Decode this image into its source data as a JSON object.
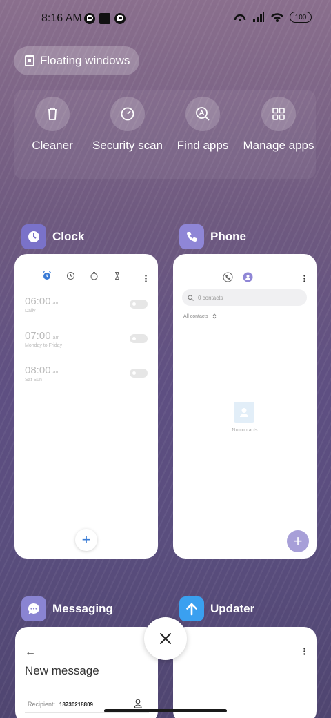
{
  "status_bar": {
    "time": "8:16 AM",
    "battery": "100"
  },
  "floating_windows": {
    "label": "Floating windows"
  },
  "shortcuts": [
    {
      "label": "Cleaner",
      "icon": "trash-icon"
    },
    {
      "label": "Security scan",
      "icon": "security-gauge-icon"
    },
    {
      "label": "Find apps",
      "icon": "find-apps-icon"
    },
    {
      "label": "Manage apps",
      "icon": "grid-icon"
    }
  ],
  "apps": {
    "clock": {
      "name": "Clock",
      "alarms": [
        {
          "time": "06:00",
          "ampm": "am",
          "repeat": "Daily"
        },
        {
          "time": "07:00",
          "ampm": "am",
          "repeat": "Monday to Friday"
        },
        {
          "time": "08:00",
          "ampm": "am",
          "repeat": "Sat Sun"
        }
      ],
      "fab": "+"
    },
    "phone": {
      "name": "Phone",
      "search_placeholder": "0 contacts",
      "filter": "All contacts",
      "empty_text": "No contacts",
      "fab": "+"
    },
    "messaging": {
      "name": "Messaging",
      "back": "←",
      "title": "New message",
      "recipient_label": "Recipient:",
      "recipient_value": "18730218809"
    },
    "updater": {
      "name": "Updater"
    }
  },
  "colors": {
    "clock_icon_bg": "#7a72c9",
    "phone_icon_bg": "#8f86d6",
    "messaging_icon_bg": "#8a84d2",
    "updater_icon_bg": "#3aa0f0",
    "clock_accent": "#3a7bd5",
    "phone_fab": "#a79fd8"
  }
}
